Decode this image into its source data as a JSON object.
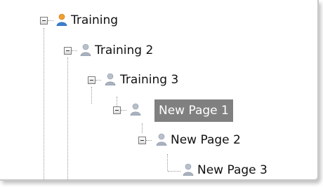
{
  "tree": {
    "items": [
      {
        "label": "Training",
        "icon": "user-blue-icon"
      },
      {
        "label": "Training 2",
        "icon": "user-grey-icon"
      },
      {
        "label": "Training 3",
        "icon": "user-grey-icon"
      },
      {
        "label": "New Page 1",
        "icon": "user-grey-icon",
        "selected": true
      },
      {
        "label": "New Page 2",
        "icon": "user-grey-icon"
      },
      {
        "label": "New Page 3",
        "icon": "user-grey-icon"
      }
    ]
  }
}
